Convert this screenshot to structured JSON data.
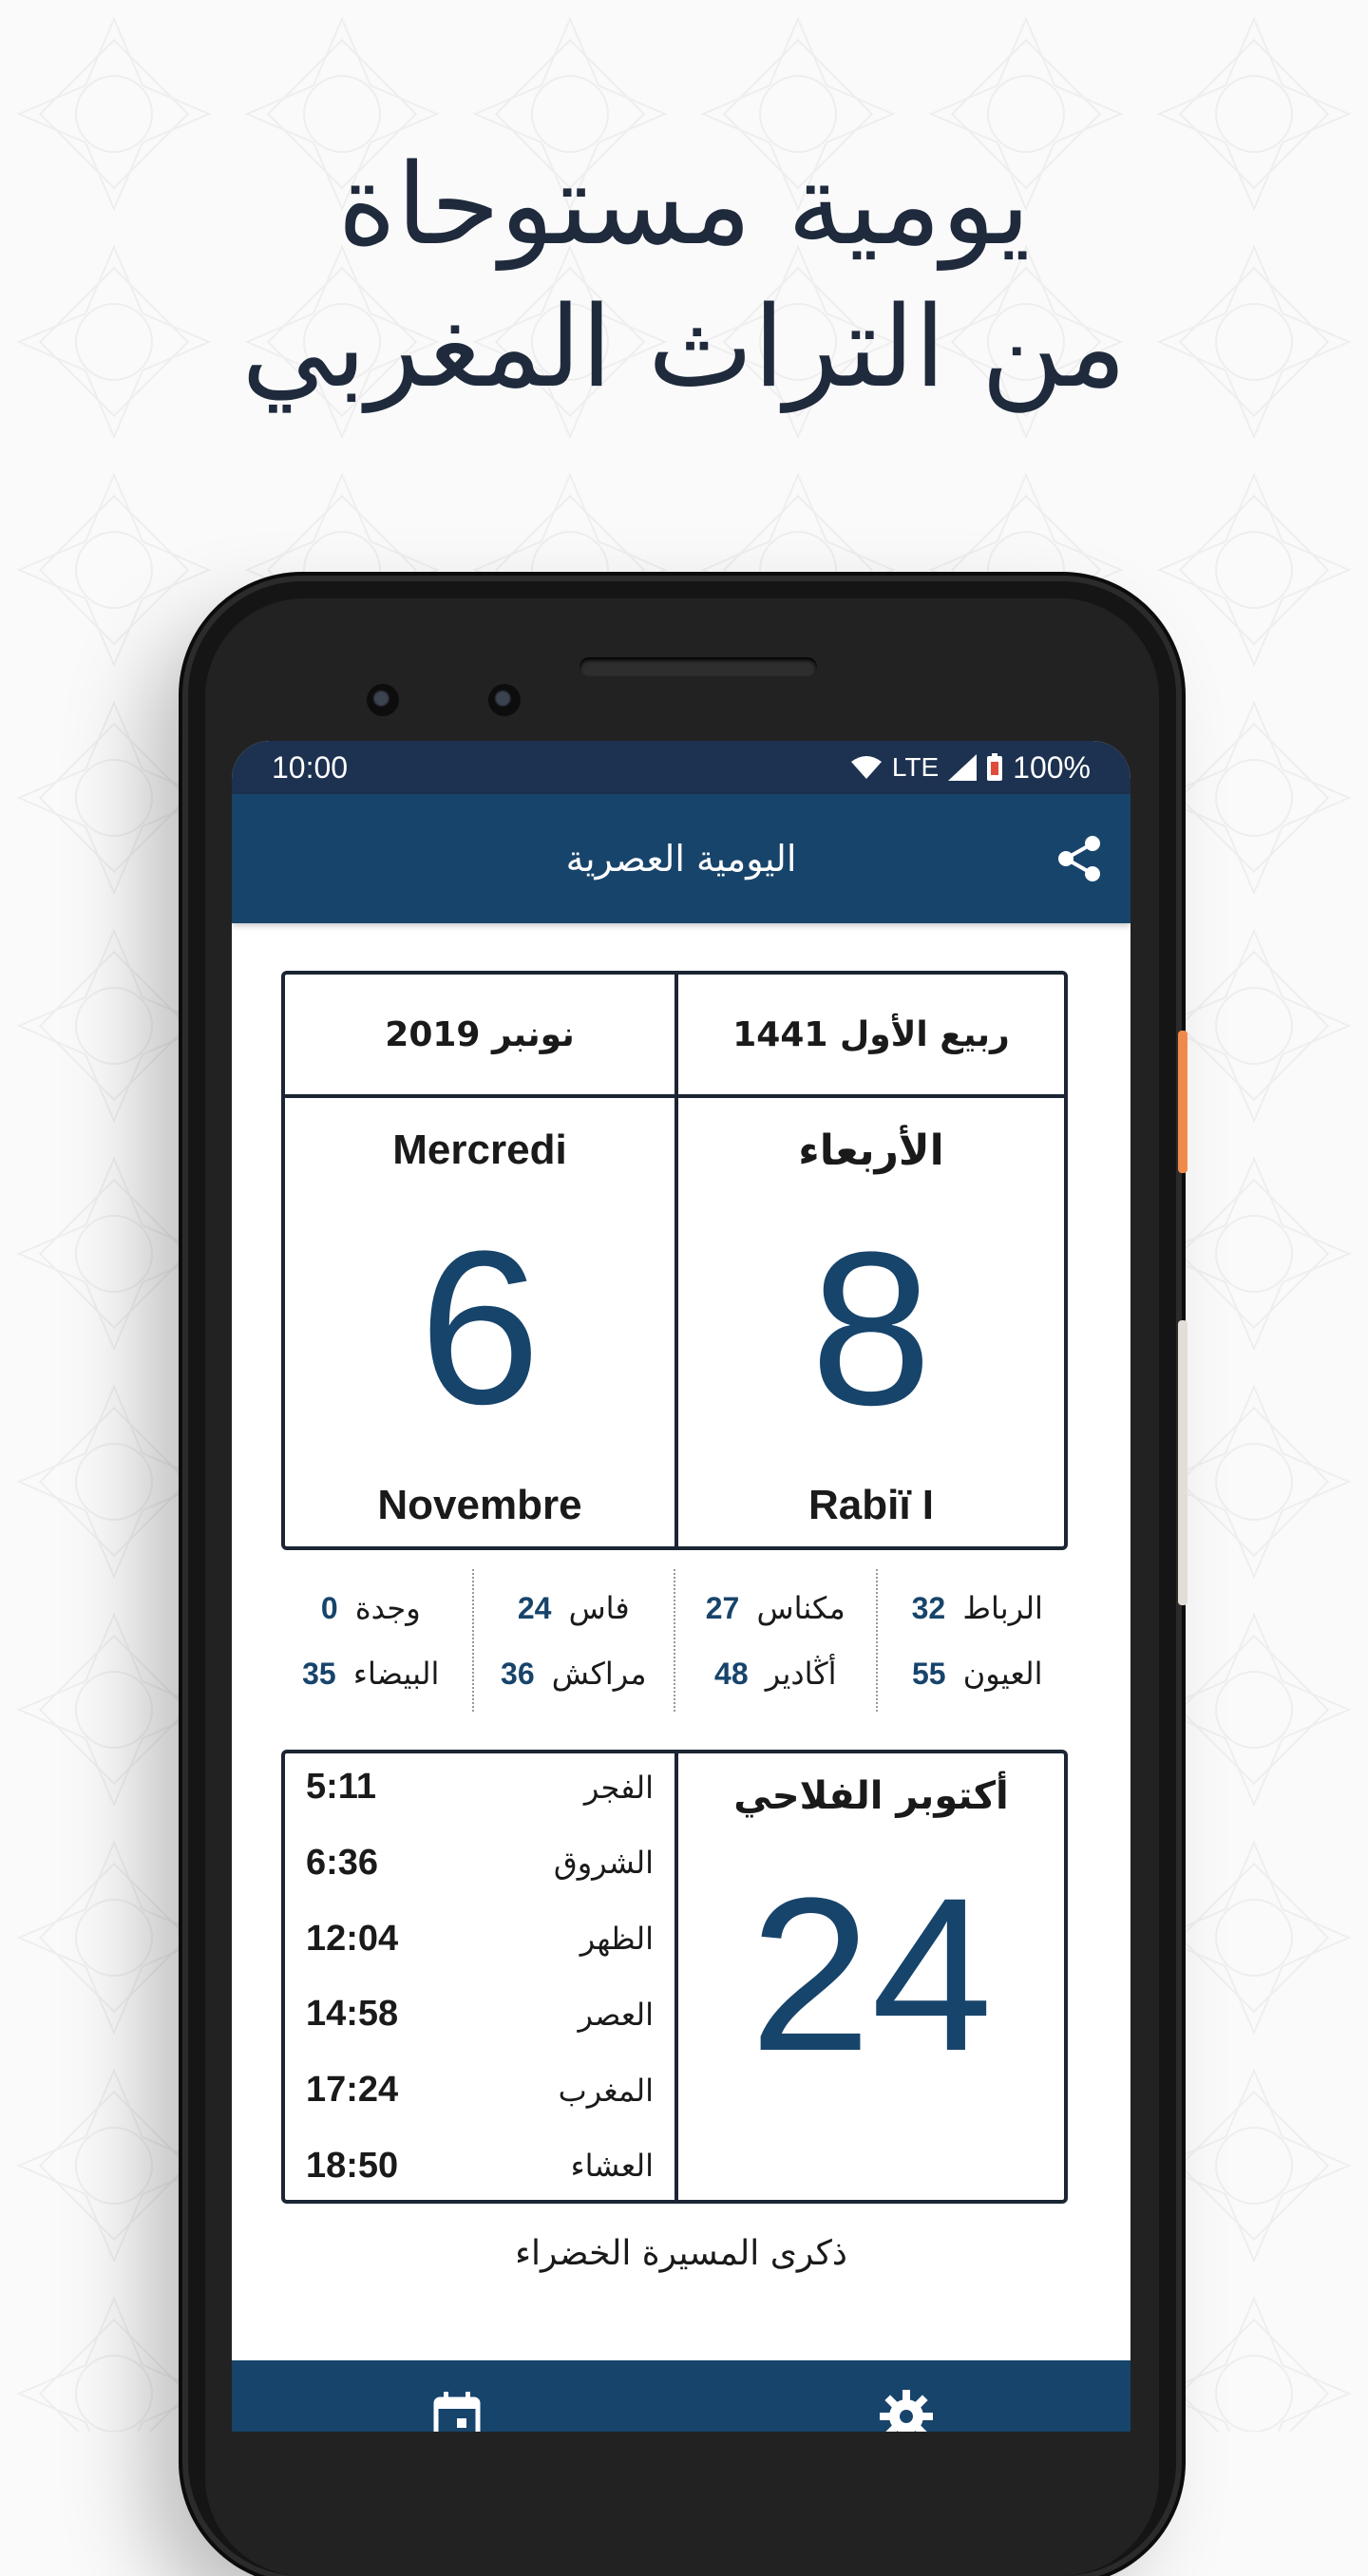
{
  "headline": {
    "line1": "يومية مستوحاة",
    "line2": "من التراث المغربي"
  },
  "status_bar": {
    "time": "10:00",
    "network": "LTE",
    "battery": "100%"
  },
  "app_bar": {
    "title": "اليومية العصرية",
    "share_icon": "share-icon"
  },
  "calendar": {
    "gregorian_month_year_ar": "نونبر 2019",
    "hijri_month_year": "ربيع الأول 1441",
    "day_name_fr": "Mercredi",
    "day_name_ar": "الأربعاء",
    "gregorian_day": "6",
    "hijri_day": "8",
    "gregorian_month_fr": "Novembre",
    "hijri_month_latin": "Rabiï I"
  },
  "cities": [
    {
      "top": {
        "name": "الرباط",
        "value": "32"
      },
      "bottom": {
        "name": "العيون",
        "value": "55"
      }
    },
    {
      "top": {
        "name": "مكناس",
        "value": "27"
      },
      "bottom": {
        "name": "أڭادير",
        "value": "48"
      }
    },
    {
      "top": {
        "name": "فاس",
        "value": "24"
      },
      "bottom": {
        "name": "مراكش",
        "value": "36"
      }
    },
    {
      "top": {
        "name": "وجدة",
        "value": "0"
      },
      "bottom": {
        "name": "البيضاء",
        "value": "35"
      }
    }
  ],
  "prayers": [
    {
      "name": "الفجر",
      "time": "5:11"
    },
    {
      "name": "الشروق",
      "time": "6:36"
    },
    {
      "name": "الظهر",
      "time": "12:04"
    },
    {
      "name": "العصر",
      "time": "14:58"
    },
    {
      "name": "المغرب",
      "time": "17:24"
    },
    {
      "name": "العشاء",
      "time": "18:50"
    }
  ],
  "agricultural": {
    "title": "أكتوبر الفلاحي",
    "day": "24"
  },
  "event": "ذكرى المسيرة الخضراء",
  "bottom_nav": {
    "items": [
      "calendar-icon",
      "settings-icon"
    ]
  },
  "colors": {
    "primary": "#17446b",
    "status_bar": "#1d3150",
    "accent_side_button": "#f08a4b"
  }
}
